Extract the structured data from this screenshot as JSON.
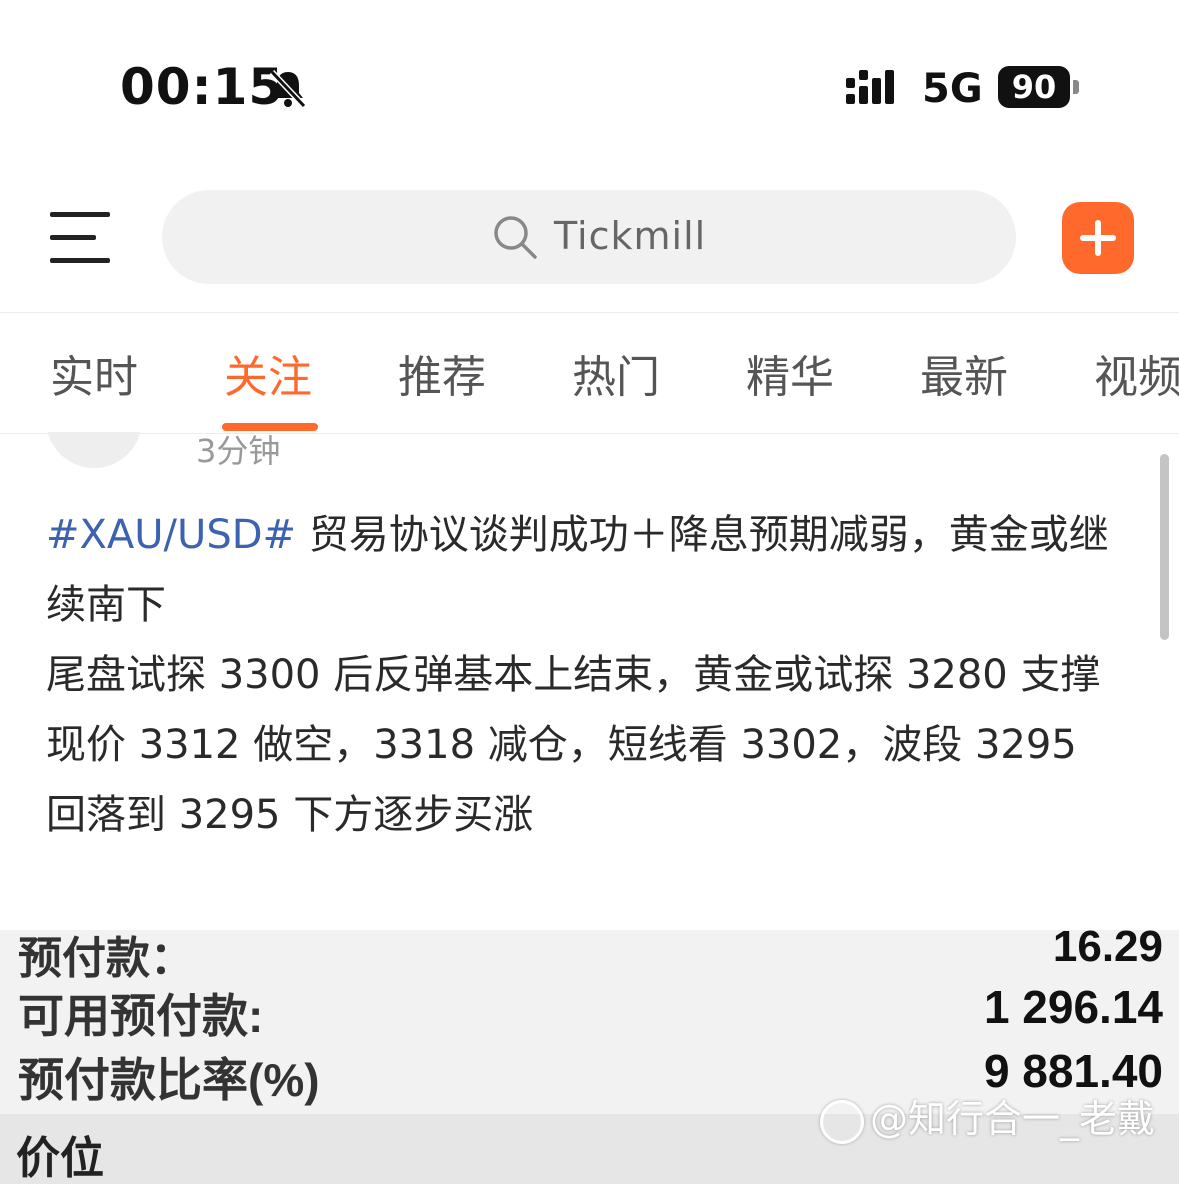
{
  "status": {
    "time": "00:15",
    "network": "5G",
    "battery": "90"
  },
  "header": {
    "search_placeholder": "Tickmill"
  },
  "tabs": [
    {
      "label": "实时"
    },
    {
      "label": "关注"
    },
    {
      "label": "推荐"
    },
    {
      "label": "热门"
    },
    {
      "label": "精华"
    },
    {
      "label": "最新"
    },
    {
      "label": "视频"
    }
  ],
  "post": {
    "time": "3分钟",
    "hashtag": "#XAU/USD#",
    "line1": " 贸易协议谈判成功＋降息预期减弱，黄金或继续南下",
    "line2": "尾盘试探 3300 后反弹基本上结束，黄金或试探 3280 支撑",
    "line3": "现价 3312 做空，3318 减仓，短线看 3302，波段 3295",
    "line4": "回落到 3295 下方逐步买涨"
  },
  "screenshot": {
    "rows": [
      {
        "label": "预付款：",
        "value": "16.29"
      },
      {
        "label": "可用预付款:",
        "value": "1 296.14"
      },
      {
        "label": "预付款比率(%)",
        "value": "9 881.40"
      }
    ],
    "section": "价位"
  },
  "watermark": "@知行合一_老戴",
  "colors": {
    "accent": "#ff6a2c",
    "hashtag": "#3c62b0"
  }
}
